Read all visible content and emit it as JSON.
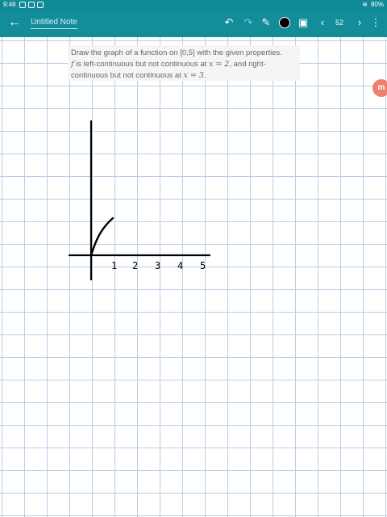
{
  "status_bar": {
    "time": "9:46",
    "battery": "80%"
  },
  "app_bar": {
    "back_icon": "←",
    "note_title": "Untitled Note",
    "undo_icon": "↶",
    "redo_icon": "↷",
    "pen_icon": "✎",
    "pen_color": "#000000",
    "page_icon": "▣",
    "prev_icon": "‹",
    "page_number": "52",
    "next_icon": "›",
    "menu_icon": "⋮"
  },
  "prompt": {
    "line1": "Draw the graph of a function on [0,5] with the given properties.",
    "line2_var": "f",
    "line2_rest": " is left-continuous but not continuous at ",
    "line2_x": "x = 2",
    "line2_tail": ", and right-",
    "line3_lead": "continuous but not continuous at ",
    "line3_x": "x = 3",
    "line3_tail": "."
  },
  "handwriting": {
    "tick_labels": [
      "1",
      "2",
      "3",
      "4",
      "5"
    ]
  },
  "colors": {
    "app_bar": "#138d9a",
    "grid": "#b8cfe8",
    "ink": "#000000"
  }
}
